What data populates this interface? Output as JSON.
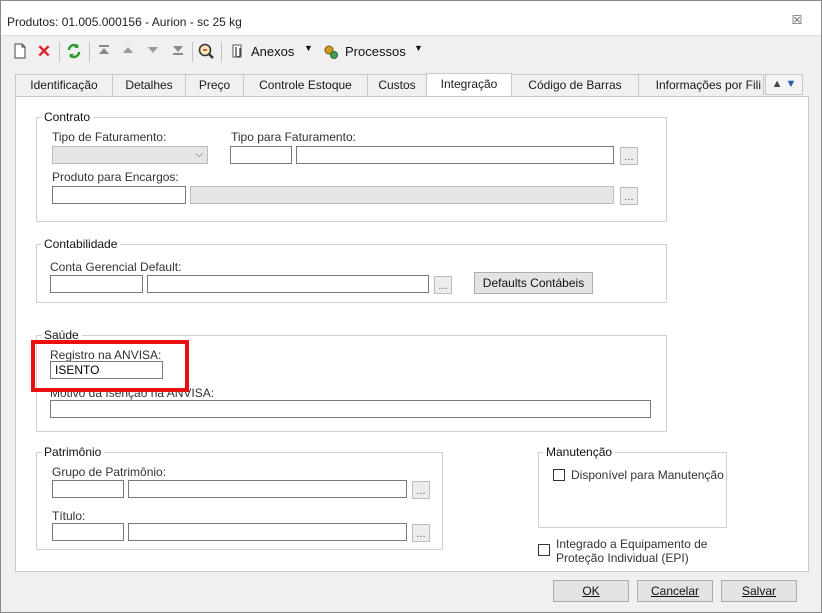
{
  "window": {
    "title": "Produtos: 01.005.000156 - Aurion - sc 25 kg",
    "close_glyph": "☒"
  },
  "toolbar": {
    "anexos_label": "Anexos",
    "processos_label": "Processos",
    "icons": [
      "new-icon",
      "delete-icon",
      "refresh-icon",
      "first-icon",
      "previous-icon",
      "next-icon",
      "last-icon",
      "search-icon",
      "attachments-icon",
      "processes-icon"
    ]
  },
  "tabs": [
    {
      "label": "Identificação"
    },
    {
      "label": "Detalhes"
    },
    {
      "label": "Preço"
    },
    {
      "label": "Controle Estoque"
    },
    {
      "label": "Custos"
    },
    {
      "label": "Integração",
      "active": true
    },
    {
      "label": "Código de Barras"
    },
    {
      "label": "Informações por Fili"
    }
  ],
  "contrato": {
    "title": "Contrato",
    "tipo_faturamento_label": "Tipo de Faturamento:",
    "tipo_para_faturamento_label": "Tipo para Faturamento:",
    "produto_encargos_label": "Produto para Encargos:",
    "dots": "..."
  },
  "contabilidade": {
    "title": "Contabilidade",
    "conta_gerencial_label": "Conta Gerencial Default:",
    "defaults_button": "Defaults Contábeis",
    "dots": "..."
  },
  "saude": {
    "title": "Saúde",
    "registro_label": "Registro na ANVISA:",
    "registro_value": "ISENTO",
    "motivo_label": "Motivo da Isenção na ANVISA:"
  },
  "patrimonio": {
    "title": "Patrimônio",
    "grupo_label": "Grupo de Patrimônio:",
    "titulo_label": "Título:",
    "dots": "..."
  },
  "manutencao": {
    "title": "Manutenção",
    "disponivel_label": "Disponível para Manutenção",
    "disponivel_checked": false
  },
  "epi": {
    "label_line1": "Integrado a Equipamento de",
    "label_line2": "Proteção Individual (EPI)",
    "checked": false
  },
  "footer": {
    "ok_label": "OK",
    "cancelar_label": "Cancelar",
    "salvar_label": "Salvar"
  },
  "colors": {
    "highlight": "#e81010",
    "panel_bg": "#ffffff",
    "window_bg": "#f0f0f0"
  }
}
